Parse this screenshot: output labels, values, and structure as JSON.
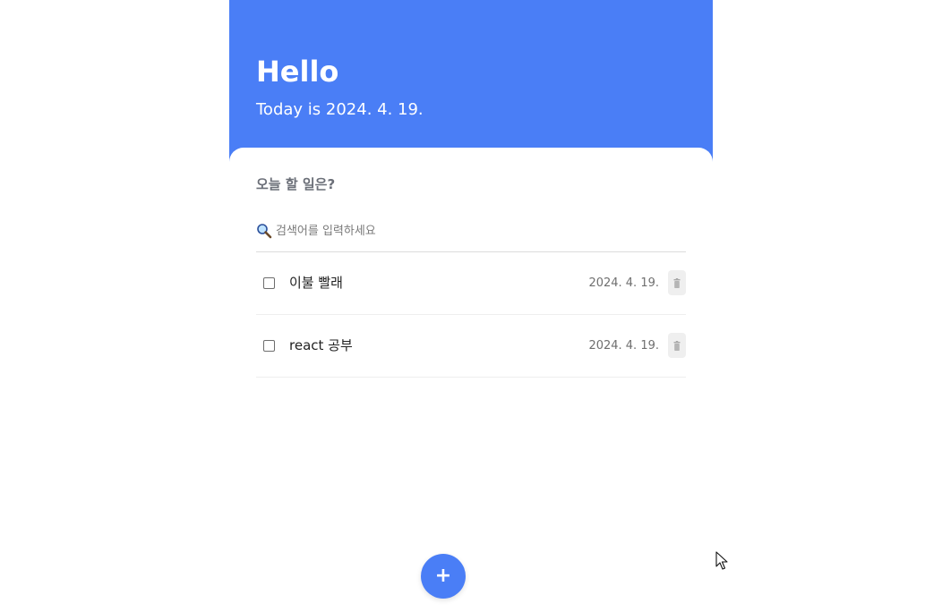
{
  "header": {
    "greeting": "Hello",
    "today_text": "Today is 2024. 4. 19.",
    "background_color": "#4a7ef6"
  },
  "todo_section": {
    "title": "오늘 할 일은?",
    "search": {
      "icon": "magnifier-icon",
      "value": "",
      "placeholder": "검색어를 입력하세요"
    },
    "items": [
      {
        "text": "이불 빨래",
        "date": "2024. 4. 19.",
        "checked": false,
        "delete_icon": "trash-icon"
      },
      {
        "text": "react 공부",
        "date": "2024. 4. 19.",
        "checked": false,
        "delete_icon": "trash-icon"
      }
    ]
  },
  "add_button": {
    "label": "+",
    "color": "#4a7ef6"
  }
}
